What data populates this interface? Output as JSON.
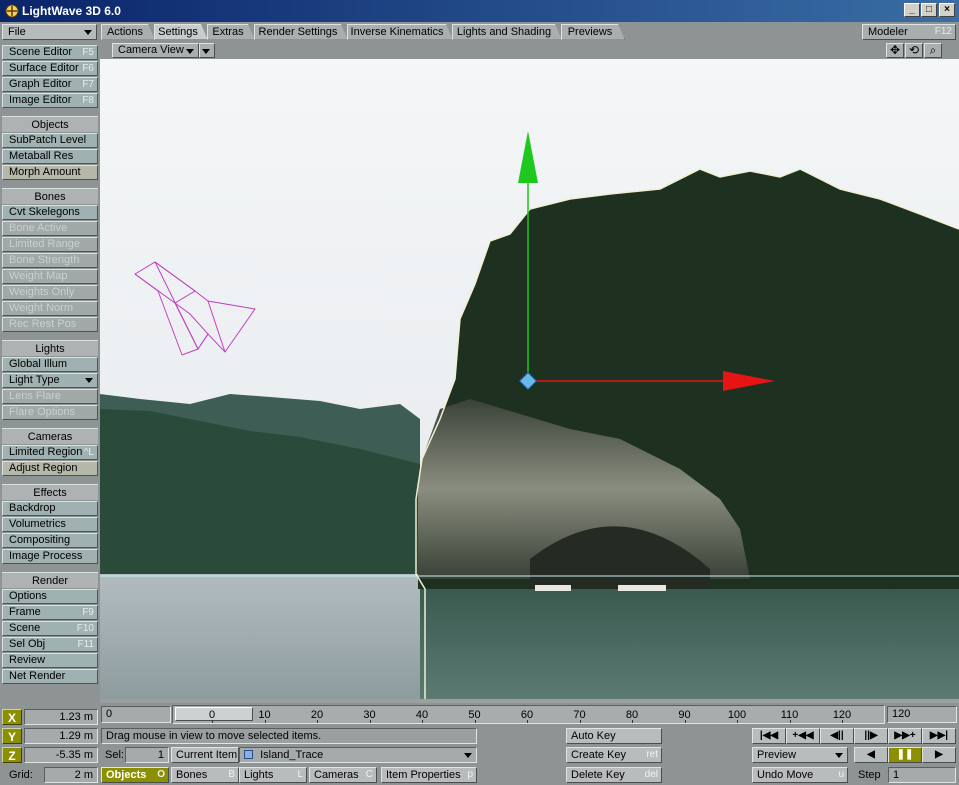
{
  "window": {
    "title": "LightWave 3D 6.0"
  },
  "file_menu": {
    "label": "File"
  },
  "tabs": [
    {
      "label": "Actions",
      "active": false
    },
    {
      "label": "Settings",
      "active": true
    },
    {
      "label": "Extras",
      "active": false
    },
    {
      "label": "Render Settings",
      "active": false
    },
    {
      "label": "Inverse Kinematics",
      "active": false
    },
    {
      "label": "Lights and Shading",
      "active": false
    },
    {
      "label": "Previews",
      "active": false
    }
  ],
  "modeler": {
    "label": "Modeler",
    "shortcut": "F12"
  },
  "view": {
    "mode": "Camera View"
  },
  "sidebar": {
    "editors": [
      {
        "label": "Scene Editor",
        "shortcut": "F5"
      },
      {
        "label": "Surface Editor",
        "shortcut": "F6"
      },
      {
        "label": "Graph Editor",
        "shortcut": "F7"
      },
      {
        "label": "Image Editor",
        "shortcut": "F8"
      }
    ],
    "objects": {
      "title": "Objects",
      "items": [
        {
          "label": "SubPatch Level"
        },
        {
          "label": "Metaball Res"
        },
        {
          "label": "Morph Amount"
        }
      ]
    },
    "bones": {
      "title": "Bones",
      "items": [
        {
          "label": "Cvt Skelegons",
          "enabled": true
        },
        {
          "label": "Bone Active",
          "enabled": false
        },
        {
          "label": "Limited Range",
          "enabled": false
        },
        {
          "label": "Bone Strength",
          "enabled": false
        },
        {
          "label": "Weight Map",
          "enabled": false
        },
        {
          "label": "Weights Only",
          "enabled": false
        },
        {
          "label": "Weight Norm",
          "enabled": false
        },
        {
          "label": "Rec Rest Pos",
          "enabled": false
        }
      ]
    },
    "lights": {
      "title": "Lights",
      "items": [
        {
          "label": "Global Illum",
          "enabled": true
        },
        {
          "label": "Light Type",
          "enabled": true
        },
        {
          "label": "Lens Flare",
          "enabled": false
        },
        {
          "label": "Flare Options",
          "enabled": false
        }
      ]
    },
    "cameras": {
      "title": "Cameras",
      "items": [
        {
          "label": "Limited Region",
          "shortcut": "^L"
        },
        {
          "label": "Adjust Region",
          "shortcut": ""
        }
      ]
    },
    "effects": {
      "title": "Effects",
      "items": [
        {
          "label": "Backdrop"
        },
        {
          "label": "Volumetrics"
        },
        {
          "label": "Compositing"
        },
        {
          "label": "Image Process"
        }
      ]
    },
    "render": {
      "title": "Render",
      "items": [
        {
          "label": "Options",
          "shortcut": ""
        },
        {
          "label": "Frame",
          "shortcut": "F9"
        },
        {
          "label": "Scene",
          "shortcut": "F10"
        },
        {
          "label": "Sel Obj",
          "shortcut": "F11"
        },
        {
          "label": "Review",
          "shortcut": ""
        },
        {
          "label": "Net Render",
          "shortcut": ""
        }
      ]
    }
  },
  "timeline": {
    "start": "0",
    "end": "120",
    "ticks": [
      "0",
      "10",
      "20",
      "30",
      "40",
      "50",
      "60",
      "70",
      "80",
      "90",
      "100",
      "110",
      "120"
    ],
    "current_frame": "0"
  },
  "coords": {
    "x": {
      "label": "X",
      "value": "1.23 m"
    },
    "y": {
      "label": "Y",
      "value": "1.29 m"
    },
    "z": {
      "label": "Z",
      "value": "-5.35 m"
    },
    "grid": {
      "label": "Grid:",
      "value": "2 m"
    }
  },
  "status": {
    "message": "Drag mouse in view to move selected items.",
    "sel_label": "Sel:",
    "sel_count": "1",
    "current_item_label": "Current Item",
    "current_item": "Island_Trace"
  },
  "item_types": [
    {
      "label": "Objects",
      "shortcut": "O",
      "active": true
    },
    {
      "label": "Bones",
      "shortcut": "B",
      "active": false
    },
    {
      "label": "Lights",
      "shortcut": "L",
      "active": false
    },
    {
      "label": "Cameras",
      "shortcut": "C",
      "active": false
    }
  ],
  "item_properties": {
    "label": "Item Properties",
    "shortcut": "p"
  },
  "keys": {
    "auto_key": "Auto Key",
    "create_key": "Create Key",
    "create_key_shortcut": "ret",
    "delete_key": "Delete Key",
    "delete_key_shortcut": "del"
  },
  "playback": {
    "buttons": [
      "|◀◀",
      "+◀◀",
      "◀||",
      "||▶",
      "▶▶+",
      "▶▶|"
    ],
    "preview_label": "Preview",
    "undo_label": "Undo Move",
    "undo_shortcut": "u",
    "step_label": "Step",
    "step_value": "1"
  },
  "colors": {
    "panel": "#8e9494",
    "button": "#9fb1b1",
    "axis_label": "#8c9000",
    "y_axis_handle": "#1ec81e",
    "x_axis_handle": "#e61414",
    "camera_wire": "#c040c0"
  }
}
